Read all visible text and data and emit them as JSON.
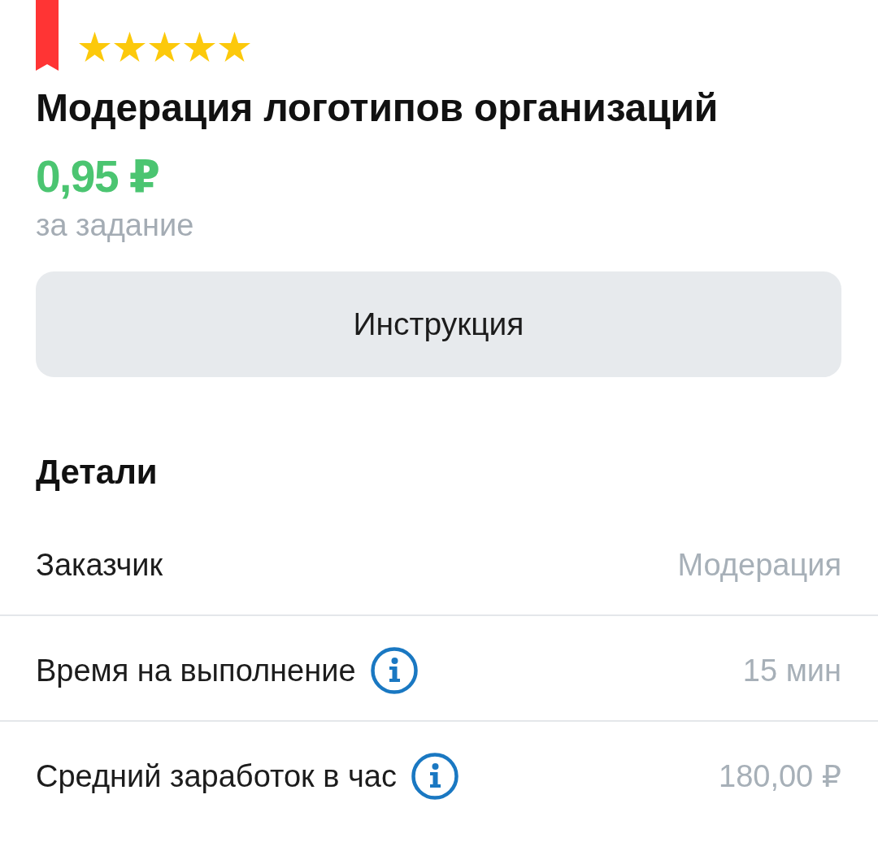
{
  "task": {
    "bookmarked": true,
    "stars": 5,
    "title": "Модерация логотипов организаций",
    "price": "0,95 ₽",
    "price_note": "за задание"
  },
  "instruction_button": {
    "label": "Инструкция"
  },
  "details": {
    "heading": "Детали",
    "rows": [
      {
        "label": "Заказчик",
        "value": "Модерация",
        "info": false
      },
      {
        "label": "Время на выполнение",
        "value": "15 мин",
        "info": true
      },
      {
        "label": "Средний заработок в час",
        "value": "180,00 ₽",
        "info": true
      }
    ]
  }
}
